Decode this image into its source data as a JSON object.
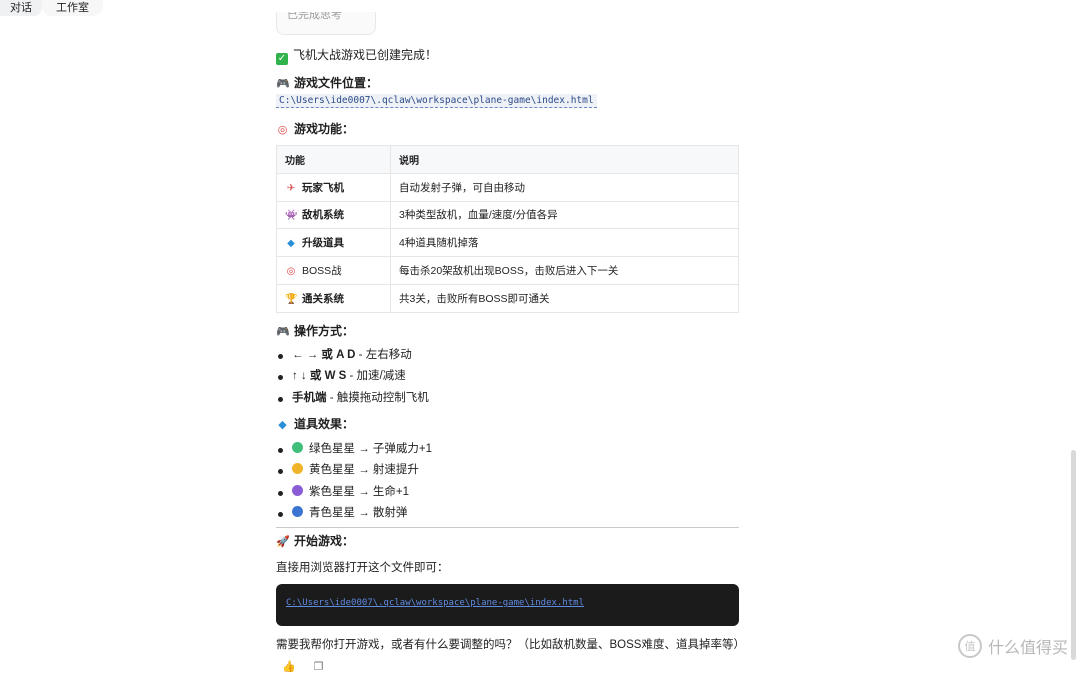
{
  "tabs": [
    "对话",
    "工作室"
  ],
  "ghost_text": "已完成思考",
  "created": "飞机大战游戏已创建完成！",
  "file_location": {
    "heading": "游戏文件位置：",
    "path": "C:\\Users\\ide0007\\.qclaw\\workspace\\plane-game\\index.html"
  },
  "features": {
    "heading": "游戏功能：",
    "columns": [
      "功能",
      "说明"
    ],
    "rows": [
      {
        "name": "玩家飞机",
        "icon": "plane-icon",
        "desc": "自动发射子弹，可自由移动"
      },
      {
        "name": "敌机系统",
        "icon": "alien-icon",
        "desc": "3种类型敌机，血量/速度/分值各异"
      },
      {
        "name": "升级道具",
        "icon": "gem-icon",
        "desc": "4种道具随机掉落"
      },
      {
        "name": "BOSS战",
        "icon": "target-icon",
        "desc": "每击杀20架敌机出现BOSS，击败后进入下一关"
      },
      {
        "name": "通关系统",
        "icon": "trophy-icon",
        "desc": "共3关，击败所有BOSS即可通关"
      }
    ]
  },
  "controls": {
    "heading": "操作方式：",
    "items": [
      {
        "key": "← → 或 A D",
        "desc": " - 左右移动"
      },
      {
        "key": "↑ ↓ 或 W S",
        "desc": " - 加速/减速"
      },
      {
        "key": "手机端",
        "desc": " - 触摸拖动控制飞机"
      }
    ]
  },
  "items": {
    "heading": "道具效果：",
    "list": [
      {
        "color": "#3fbf7a",
        "text": "绿色星星 → 子弹威力+1"
      },
      {
        "color": "#f0b429",
        "text": "黄色星星 → 射速提升"
      },
      {
        "color": "#8a5cd6",
        "text": "紫色星星 → 生命+1"
      },
      {
        "color": "#3b74d1",
        "text": "青色星星 → 散射弹"
      }
    ]
  },
  "start": {
    "heading": "开始游戏：",
    "desc": "直接用浏览器打开这个文件即可：",
    "code": "C:\\Users\\ide0007\\.qclaw\\workspace\\plane-game\\index.html"
  },
  "follow_up": "需要我帮你打开游戏，或者有什么要调整的吗？（比如敌机数量、BOSS难度、道具掉率等）",
  "watermark": "什么值得买",
  "colors": {
    "code_bg": "#1b1b1c",
    "link": "#2c4b8a",
    "check": "#2fb34a"
  }
}
